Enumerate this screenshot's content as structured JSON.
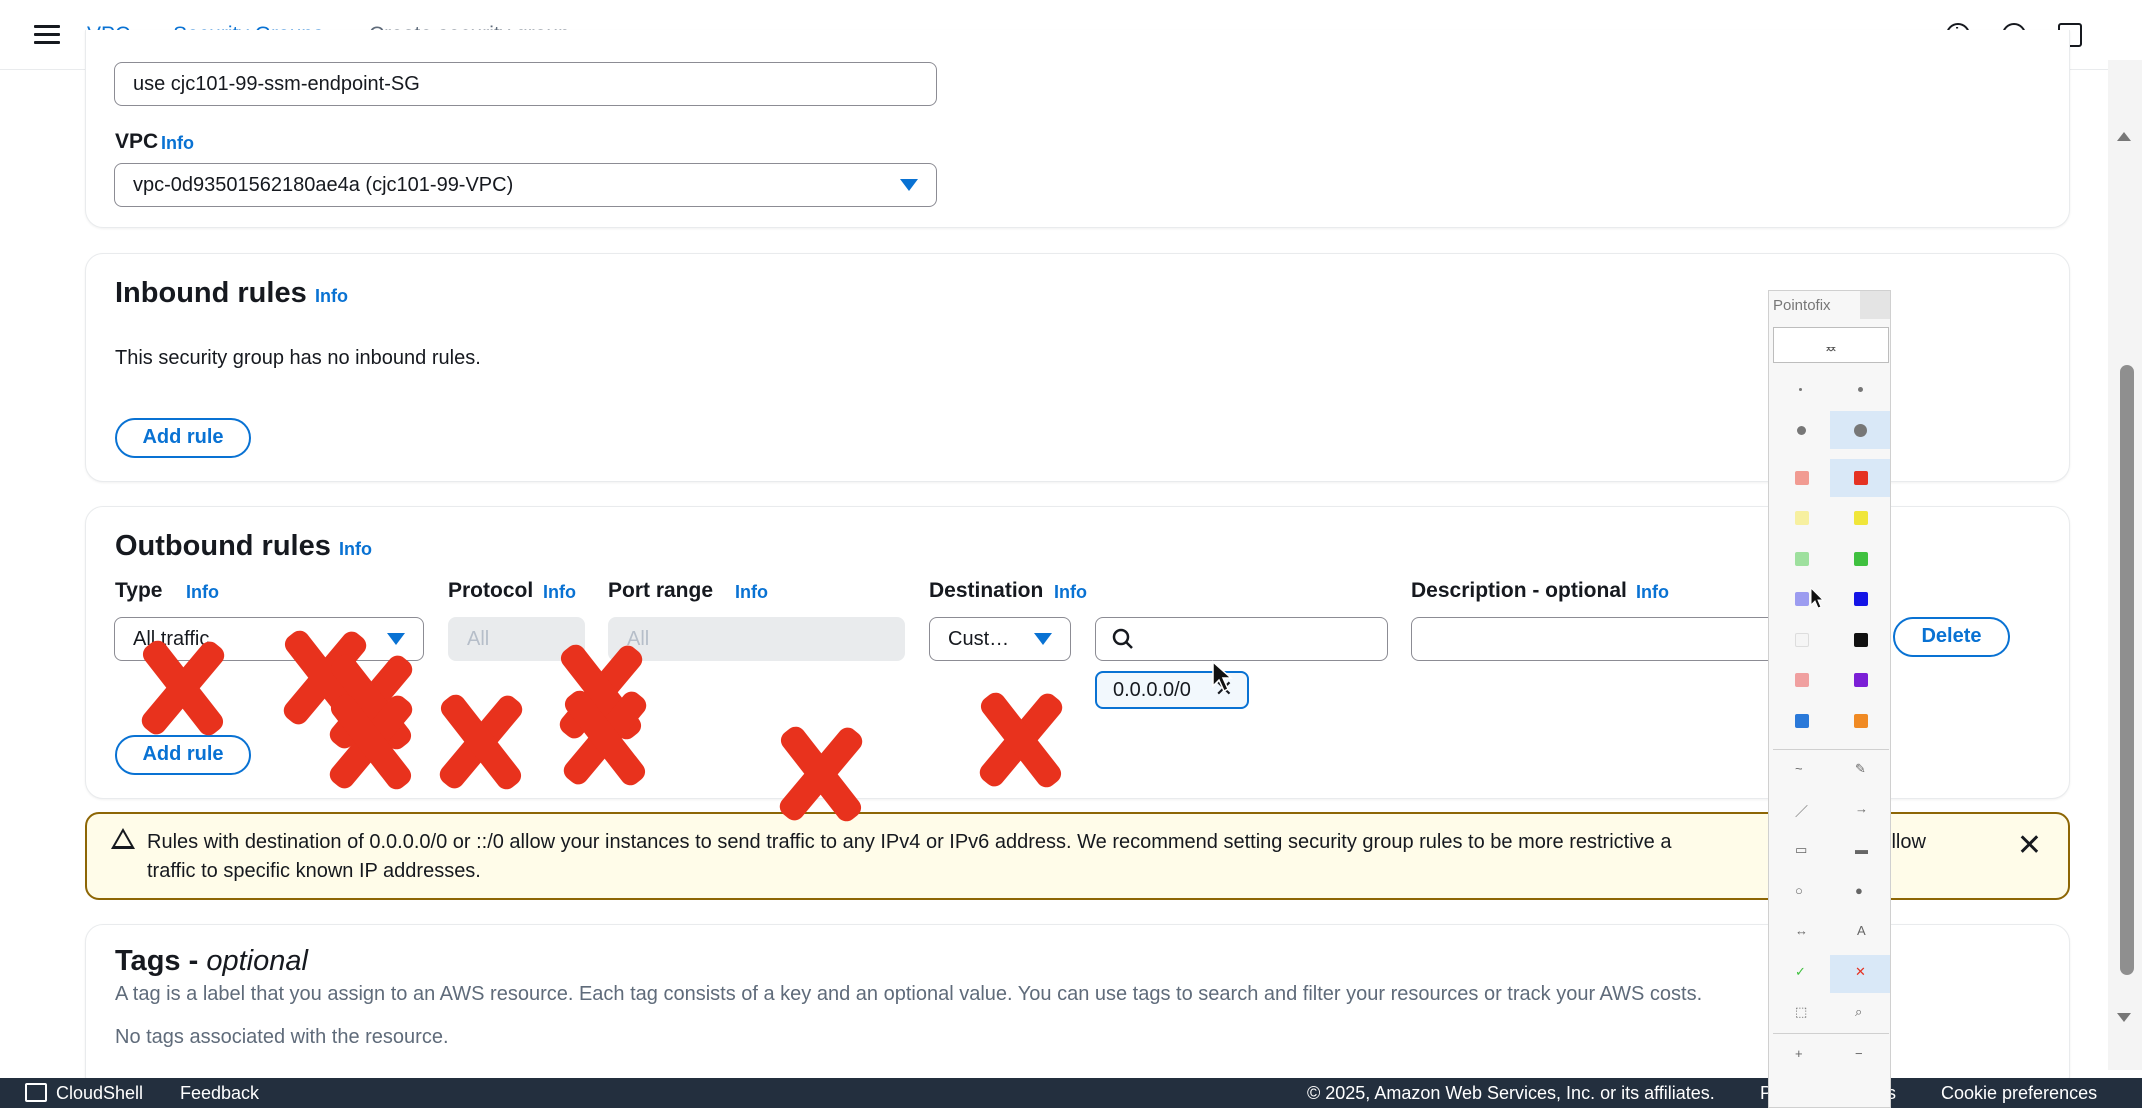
{
  "breadcrumb": {
    "items": [
      "VPC",
      "Security Groups"
    ],
    "current": "Create security group"
  },
  "basic": {
    "description_value": "use cjc101-99-ssm-endpoint-SG",
    "vpc_label": "VPC",
    "info": "Info",
    "vpc_value": "vpc-0d93501562180ae4a (cjc101-99-VPC)"
  },
  "inbound": {
    "title": "Inbound rules",
    "info": "Info",
    "empty_text": "This security group has no inbound rules.",
    "add_rule": "Add rule"
  },
  "outbound": {
    "title": "Outbound rules",
    "info": "Info",
    "columns": {
      "type": "Type",
      "protocol": "Protocol",
      "port_range": "Port range",
      "destination": "Destination",
      "description": "Description - optional"
    },
    "row": {
      "type_value": "All traffic",
      "protocol_value": "All",
      "port_value": "All",
      "destination_select": "Cust…",
      "destination_search": "",
      "destination_token": "0.0.0.0/0",
      "description_value": "",
      "delete": "Delete"
    },
    "add_rule": "Add rule"
  },
  "warning": {
    "text_1": "Rules with destination of 0.0.0.0/0 or ::/0 allow your instances to send traffic to any IPv4 or IPv6 address. We recommend setting security group rules to be more restrictive a",
    "text_1b": "llow",
    "text_2": "traffic to specific known IP addresses."
  },
  "tags": {
    "title": "Tags - ",
    "title_optional": "optional",
    "description": "A tag is a label that you assign to an AWS resource. Each tag consists of a key and an optional value. You can use tags to search and filter your resources or track your AWS costs.",
    "empty_text": "No tags associated with the resource."
  },
  "footer": {
    "cloudshell": "CloudShell",
    "feedback": "Feedback",
    "copyright": "© 2025, Amazon Web Services, Inc. or its affiliates.",
    "privacy_partial": "P",
    "terms_partial": "ns",
    "cookie": "Cookie preferences"
  },
  "pointofix": {
    "title": "Pointofix",
    "bar_text": "ᆽᆽ",
    "colors": [
      "#e53222",
      "#f0e63a",
      "#3fc13f",
      "#1414e6",
      "#111111",
      "#7b1fd6",
      "#f08a24",
      "#2a79d9"
    ],
    "light_colors": [
      "#f19b92",
      "#f7f0a0",
      "#9ee09e",
      "#9c9cf0",
      "#f5f5f5",
      "#f0a0a0"
    ]
  },
  "colors": {
    "accent": "#0972d3",
    "annotation_red": "#e8321d",
    "warning_border": "#8d6605",
    "warning_bg": "#fffce9",
    "footer_bg": "#232f3e"
  }
}
